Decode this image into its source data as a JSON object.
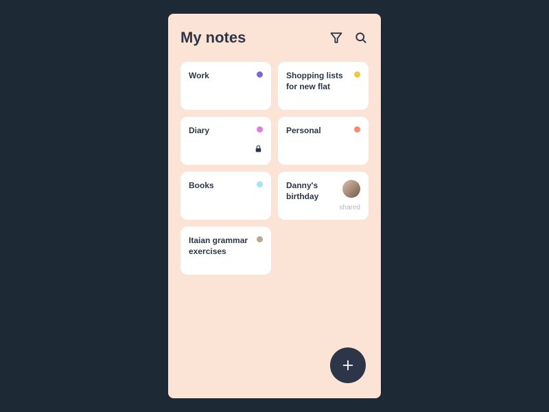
{
  "header": {
    "title": "My notes"
  },
  "notes": [
    {
      "title": "Work",
      "color": "#7866e0",
      "locked": false,
      "shared": false
    },
    {
      "title": "Shopping lists for new flat",
      "color": "#f4c445",
      "locked": false,
      "shared": false
    },
    {
      "title": "Diary",
      "color": "#e07ae6",
      "locked": true,
      "shared": false
    },
    {
      "title": "Personal",
      "color": "#f38b6f",
      "locked": false,
      "shared": false
    },
    {
      "title": "Books",
      "color": "#a0e4f5",
      "locked": false,
      "shared": false
    },
    {
      "title": "Danny's birthday",
      "color": "",
      "locked": false,
      "shared": true,
      "shared_label": "shared",
      "has_avatar": true
    },
    {
      "title": "Itaian grammar exercises",
      "color": "#b8a990",
      "locked": false,
      "shared": false
    }
  ]
}
